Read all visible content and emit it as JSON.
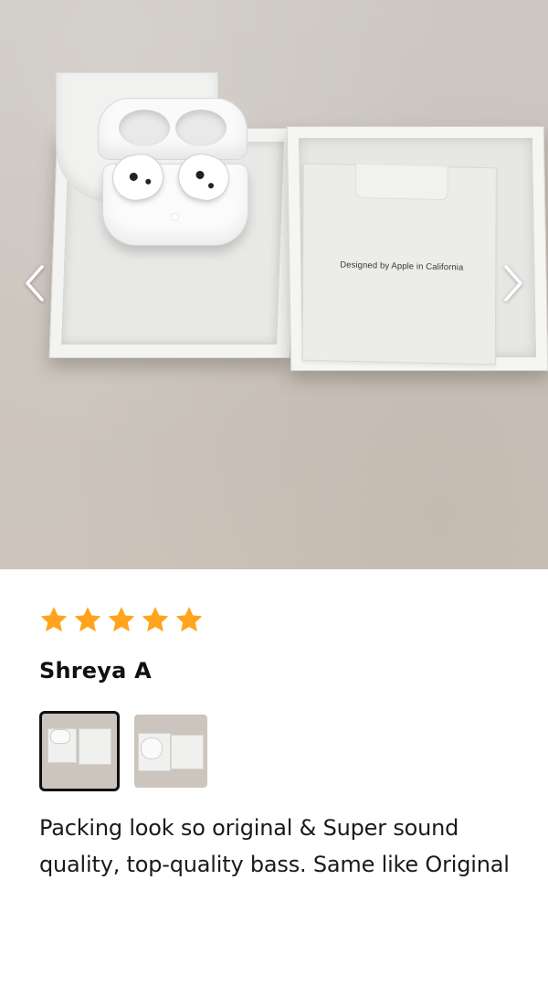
{
  "photo_viewer": {
    "photo_caption_text": "Designed by Apple in California",
    "prev_icon": "chevron-left-icon",
    "next_icon": "chevron-right-icon"
  },
  "review": {
    "rating": 5,
    "rating_max": 5,
    "star_color": "#FFA41C",
    "reviewer_name": "Shreya A",
    "thumbnails": [
      {
        "name": "thumbnail-1",
        "selected": true
      },
      {
        "name": "thumbnail-2",
        "selected": false
      }
    ],
    "text": "Packing look so original & Super sound quality, top-quality bass. Same like Original"
  }
}
